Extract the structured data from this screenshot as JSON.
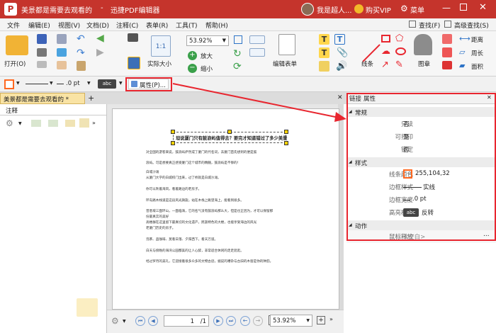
{
  "titlebar": {
    "doc_name": "美景都是需要去观看的",
    "separator": "-",
    "app_name": "迅捷PDF编辑器",
    "user": "我是超人...",
    "vip": "购买VIP",
    "menu": "菜单"
  },
  "menu": [
    "文件",
    "编辑(E)",
    "视图(V)",
    "文档(D)",
    "注释(C)",
    "表单(R)",
    "工具(T)",
    "帮助(H)"
  ],
  "menu_right": {
    "find": "查找(F)",
    "advanced_find": "高级查找(S)"
  },
  "ribbon": {
    "open": "打开(O)",
    "actual_size": "实际大小",
    "zoom": "53.92%",
    "zoom_in": "放大",
    "zoom_out": "缩小",
    "edit_form": "编辑表单",
    "line": "线条",
    "chapter": "图章",
    "distance": "距离",
    "perimeter": "周长",
    "area": "面积"
  },
  "propbar": {
    "pt": ".0 pt",
    "abc": "abc",
    "properties": "属性(P)..."
  },
  "tab": {
    "label": "美景都是需要去观看的 *",
    "add": "+"
  },
  "left": {
    "title": "注释"
  },
  "document": {
    "heading": "坦说厦门只有鼓浪屿值得去？要完才知道错过了多少美景",
    "lines": [
      "对全国的游客来说，鼓浪屿俨然成了厦门的代名词，去厦门首先想到的便是鼓",
      "浪屿。可是想要真正感受厦门这个城市的精髓，鼓浪屿是不够的！",
      "",
      "白城沙滩",
      "从厦门大学的白城校门出来，过了桥就是白城沙滩。",
      "",
      "你可以吹着海风，看着路边的老房子。",
      "",
      "环岛路木栈道是这段风光旖旎，站在木栈上眺望海上，能看到很多。",
      "",
      "曾厝垵三面环山，一面临海，它的名气没有鼓浪屿那么大，但是也正因为，才可以保留那",
      "份最真实的美好",
      "高楼群在这里留下最真切的文化遗产，民族特色的大楼，也能享受海边的风光",
      "老厦门历史的房子。",
      "",
      "泡茶、品咖啡、莫看日落、夕阳西下，看天万道。",
      "",
      "白天与傍晚的海湾公园都美的让人心醉，非常适合休闲的走走逛逛。",
      "",
      "经过罗月的美礼，它迎接着很多众多的文物古迹，据说的嘈杂与古旧的木窗是你的钟韵。"
    ]
  },
  "status": {
    "page": "1",
    "of": "/1",
    "zoom": "53.92%"
  },
  "right": {
    "tabs": [
      "链接",
      "属性"
    ],
    "sections": {
      "common": "常规",
      "style": "样式",
      "action": "动作"
    },
    "props": {
      "readonly_k": "只读",
      "readonly_v": "否",
      "printable_k": "可打印",
      "printable_v": "是",
      "locked_k": "锁定",
      "locked_v": "否",
      "linecolor_k": "线条颜色",
      "linecolor_v": "255,104,32",
      "border_style_k": "边框样式",
      "border_style_v": "实线",
      "border_width_k": "边框宽度",
      "border_width_v": ".0 pt",
      "highlight_k": "高亮模式",
      "highlight_badge": "abc",
      "highlight_v": "反转",
      "mouse_k": "鼠标释放",
      "mouse_v": "<空白>",
      "more": "..."
    }
  },
  "colors": {
    "title": "#c5342c",
    "accent": "#ff6820",
    "highlight": "#e8262f"
  }
}
